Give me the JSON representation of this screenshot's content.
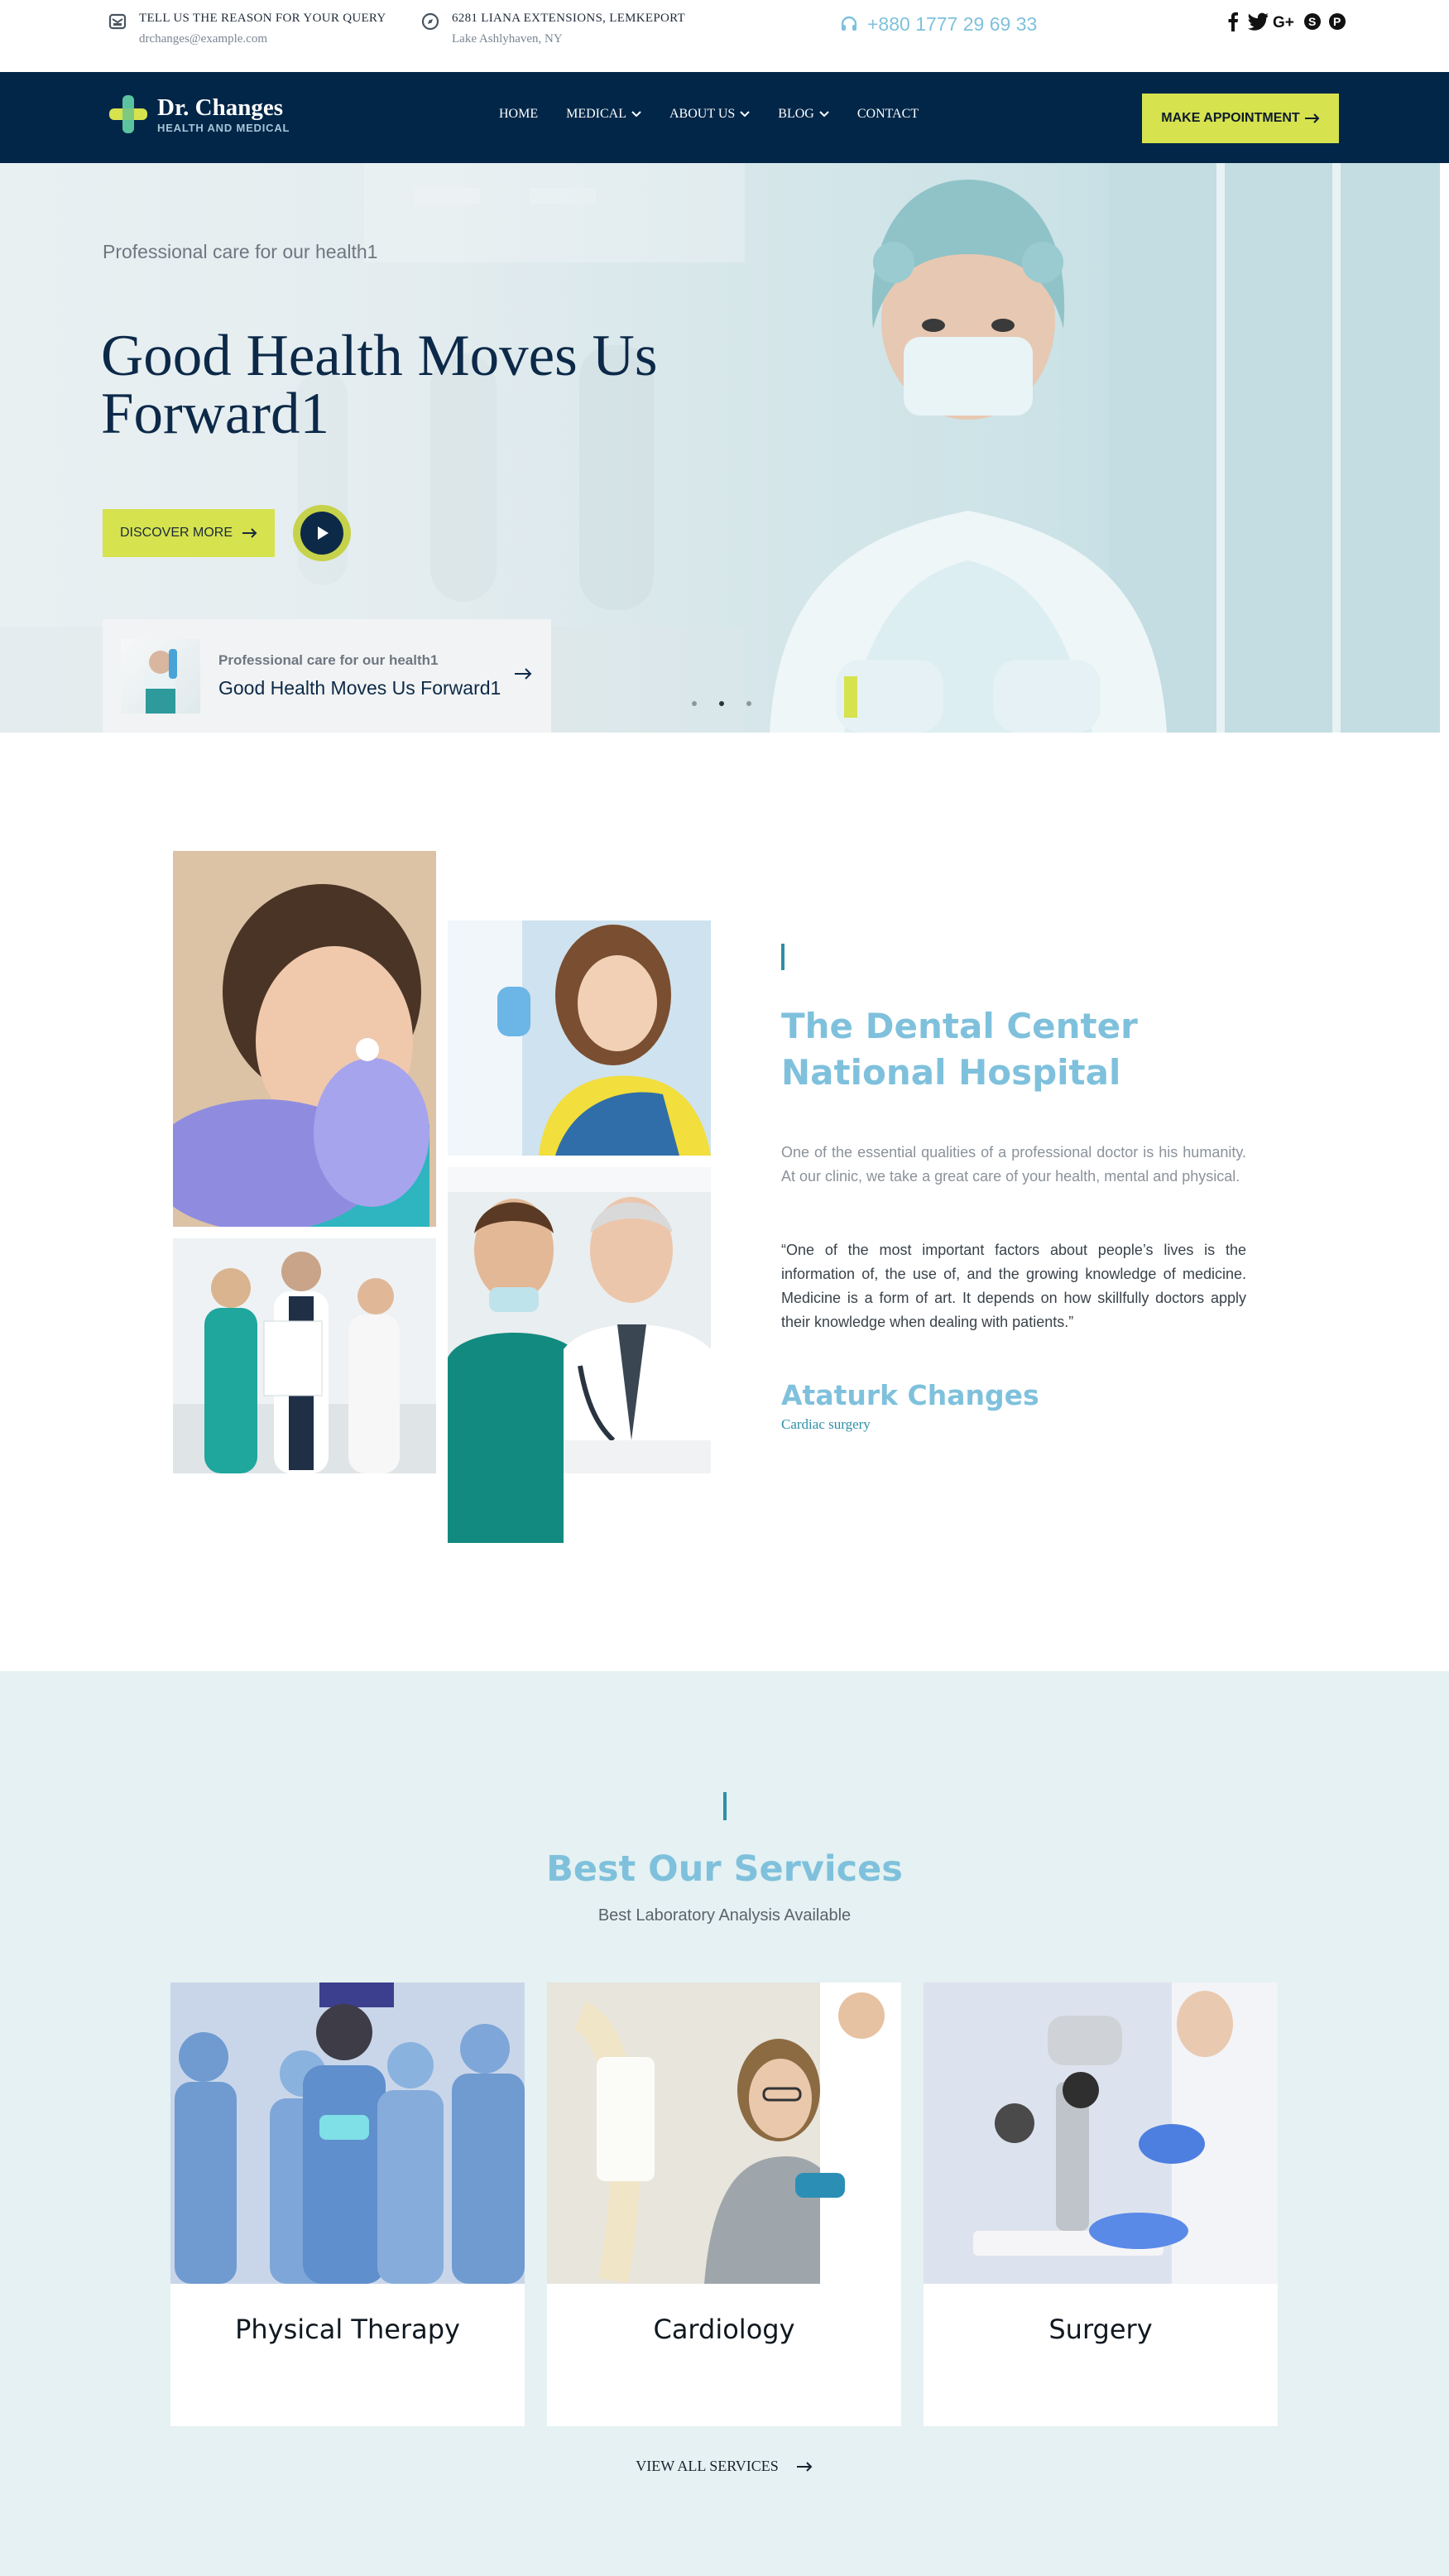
{
  "topbar": {
    "query": {
      "icon": "envelope-icon",
      "line1": "TELL US THE REASON FOR YOUR QUERY",
      "line2": "drchanges@example.com"
    },
    "address": {
      "icon": "compass-icon",
      "line1": "6281 LIANA EXTENSIONS, LEMKEPORT",
      "line2": "Lake Ashlyhaven, NY"
    },
    "phone": {
      "icon": "headset-icon",
      "number": "+880 1777 29 69 33"
    },
    "social": [
      "facebook-icon",
      "twitter-icon",
      "google-plus-icon",
      "skype-icon",
      "pinterest-icon"
    ]
  },
  "nav": {
    "logo_name": "Dr. Changes",
    "logo_tagline": "HEALTH AND MEDICAL",
    "items": [
      {
        "label": "HOME",
        "dropdown": false
      },
      {
        "label": "MEDICAL",
        "dropdown": true
      },
      {
        "label": "ABOUT US",
        "dropdown": true
      },
      {
        "label": "BLOG",
        "dropdown": true
      },
      {
        "label": "CONTACT",
        "dropdown": false
      }
    ],
    "cta_label": "MAKE APPOINTMENT"
  },
  "hero": {
    "subtitle": "Professional care for our health1",
    "title": "Good Health Moves Us Forward1",
    "discover_label": "DISCOVER MORE",
    "card": {
      "small": "Professional care for our health1",
      "title": "Good Health Moves Us Forward1"
    }
  },
  "about": {
    "title": "The Dental Center National Hospital",
    "paragraph1": "One of the essential qualities of a professional doctor is his humanity. At our clinic, we take a great care of your health, mental and physical.",
    "paragraph2": "“One of the most important factors about people’s lives is the information of, the use of, and the growing knowledge of medicine. Medicine is a form of art. It depends on how skillfully doctors apply their knowledge when dealing with patients.”",
    "author_name": "Ataturk Changes",
    "author_role": "Cardiac surgery"
  },
  "services": {
    "title": "Best Our Services",
    "subtitle": "Best Laboratory Analysis Available",
    "cards": [
      {
        "name": "Physical Therapy"
      },
      {
        "name": "Cardiology"
      },
      {
        "name": "Surgery"
      }
    ],
    "view_all_label": "VIEW ALL SERVICES"
  },
  "colors": {
    "navy": "#012648",
    "accent_yellow": "#d6e24e",
    "light_blue": "#7fc1dc",
    "teal": "#2e8fa5",
    "services_bg": "#e5f1f2"
  }
}
